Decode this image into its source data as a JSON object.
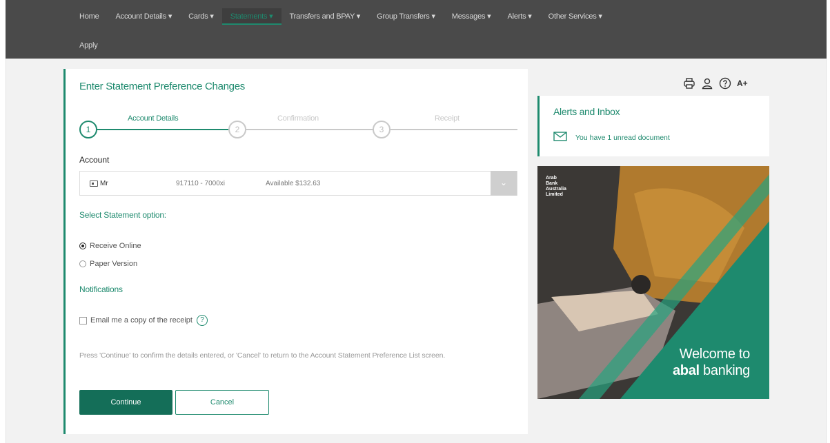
{
  "nav": {
    "items": [
      {
        "label": "Home",
        "active": false
      },
      {
        "label": "Account Details ▾",
        "active": false
      },
      {
        "label": "Cards ▾",
        "active": false
      },
      {
        "label": "Statements ▾",
        "active": true
      },
      {
        "label": "Transfers and BPAY ▾",
        "active": false
      },
      {
        "label": "Group Transfers ▾",
        "active": false
      },
      {
        "label": "Messages ▾",
        "active": false
      },
      {
        "label": "Alerts ▾",
        "active": false
      },
      {
        "label": "Other Services ▾",
        "active": false
      }
    ],
    "row2": [
      {
        "label": "Apply"
      }
    ]
  },
  "page": {
    "title": "Enter Statement Preference Changes"
  },
  "stepper": {
    "steps": [
      {
        "number": "1",
        "label": "Account Details",
        "state": "current"
      },
      {
        "number": "2",
        "label": "Confirmation",
        "state": "pending"
      },
      {
        "number": "3",
        "label": "Receipt",
        "state": "pending"
      }
    ]
  },
  "account": {
    "label": "Account",
    "name": "Mr",
    "number": "917110 - 7000xi",
    "available": "Available $132.63"
  },
  "statement_option": {
    "title": "Select Statement option:",
    "options": [
      {
        "label": "Receive Online",
        "checked": true
      },
      {
        "label": "Paper Version",
        "checked": false
      }
    ]
  },
  "notifications": {
    "title": "Notifications",
    "email_copy_label": "Email me a copy of the receipt",
    "email_copy_checked": false,
    "help_glyph": "?"
  },
  "instructions": "Press 'Continue' to confirm the details entered, or 'Cancel' to return to the Account Statement Preference List screen.",
  "buttons": {
    "continue": "Continue",
    "cancel": "Cancel"
  },
  "tools": {
    "font_size_label": "A+",
    "icons": [
      "print-icon",
      "user-icon",
      "help-icon",
      "font-size-icon"
    ]
  },
  "alerts": {
    "title": "Alerts and Inbox",
    "message": "You have 1 unread document"
  },
  "banner": {
    "bank_name": "Arab\nBank\nAustralia\nLimited",
    "line1": "Welcome to",
    "line2_bold": "abal",
    "line2_rest": " banking"
  },
  "colors": {
    "accent": "#1e8a6e",
    "nav_bg": "#4a4a4a",
    "button_primary": "#146e58"
  }
}
